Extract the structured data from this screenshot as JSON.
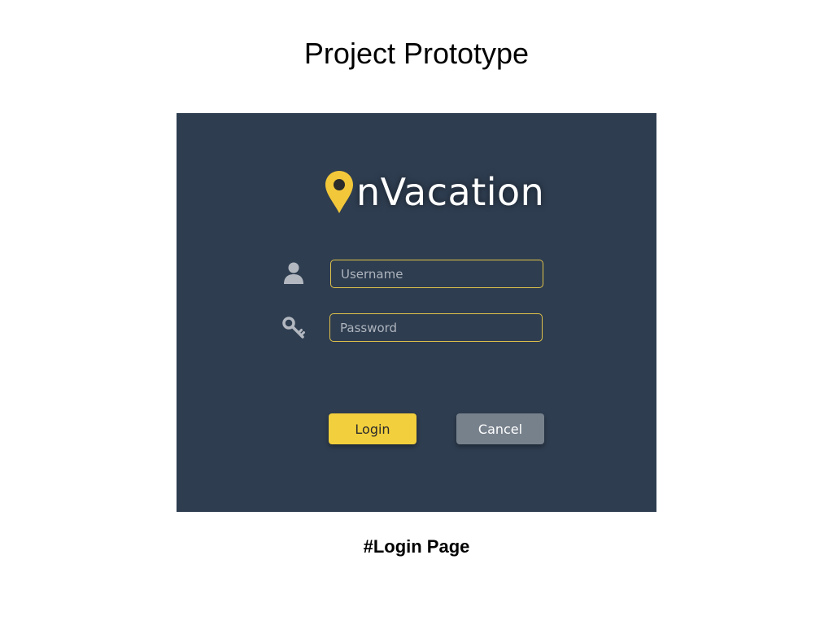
{
  "slide": {
    "title": "Project Prototype",
    "caption": "#Login Page"
  },
  "app": {
    "brand_suffix": "nVacation",
    "brand_icon": "location-pin-icon",
    "background_color": "#2e3d50",
    "accent_color": "#f2cf3c"
  },
  "form": {
    "username": {
      "icon": "user-icon",
      "placeholder": "Username",
      "value": ""
    },
    "password": {
      "icon": "key-icon",
      "placeholder": "Password",
      "value": ""
    }
  },
  "buttons": {
    "login_label": "Login",
    "cancel_label": "Cancel"
  }
}
